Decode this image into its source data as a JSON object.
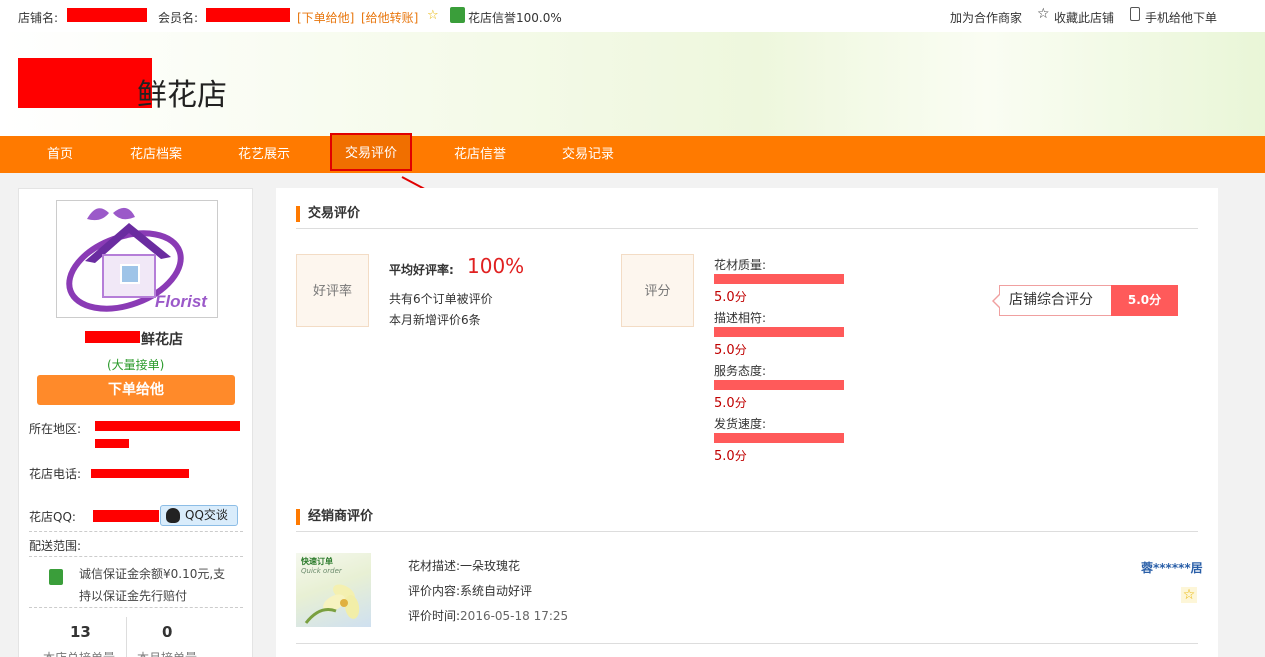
{
  "topbar": {
    "shop_label": "店铺名:",
    "member_label": "会员名:",
    "order_link": "[下单给他]",
    "transfer_link": "[给他转账]",
    "credit_text": "花店信誉100.0%",
    "partner_link": "加为合作商家",
    "favorite_link": "收藏此店铺",
    "mobile_link": "手机给他下单"
  },
  "banner": {
    "title_suffix": "鲜花店"
  },
  "nav": {
    "items": [
      "首页",
      "花店档案",
      "花艺展示",
      "交易评价",
      "花店信誉",
      "交易记录"
    ],
    "active": "交易评价"
  },
  "sidebar": {
    "logo_text": "Florist",
    "shop_name_suffix": "鲜花店",
    "tag": "(大量接单)",
    "order_button": "下单给他",
    "location_label": "所在地区:",
    "phone_label": "花店电话:",
    "qq_label": "花店QQ:",
    "qq_button": "QQ交谈",
    "delivery_label": "配送范围:",
    "deposit_text": "诚信保证金余额¥0.10元,支持以保证金先行赔付",
    "stats": [
      {
        "value": "13",
        "label": "本店总接单量"
      },
      {
        "value": "0",
        "label": "本月接单量"
      }
    ]
  },
  "reviews": {
    "title": "交易评价",
    "rate_badge": "好评率",
    "avg_label": "平均好评率:",
    "avg_value": "100%",
    "total_text": "共有6个订单被评价",
    "month_text": "本月新增评价6条",
    "score_badge": "评分",
    "scores": [
      {
        "label": "花材质量:",
        "value": "5.0",
        "unit": "分"
      },
      {
        "label": "描述相符:",
        "value": "5.0",
        "unit": "分"
      },
      {
        "label": "服务态度:",
        "value": "5.0",
        "unit": "分"
      },
      {
        "label": "发货速度:",
        "value": "5.0",
        "unit": "分"
      }
    ],
    "overall_label": "店铺综合评分",
    "overall_value": "5.0分"
  },
  "dealer_reviews": {
    "title": "经销商评价",
    "thumb_title": "快速订单",
    "thumb_sub": "Quick order",
    "items": [
      {
        "desc_label": "花材描述:",
        "desc": "一朵玫瑰花",
        "content_label": "评价内容:",
        "content": "系统自动好评",
        "time_label": "评价时间:",
        "time": "2016-05-18 17:25",
        "reviewer": "蓉******居"
      }
    ]
  },
  "colors": {
    "accent": "#ff7a00",
    "score_bar": "#ff5a5a",
    "red_text": "#e02020"
  }
}
